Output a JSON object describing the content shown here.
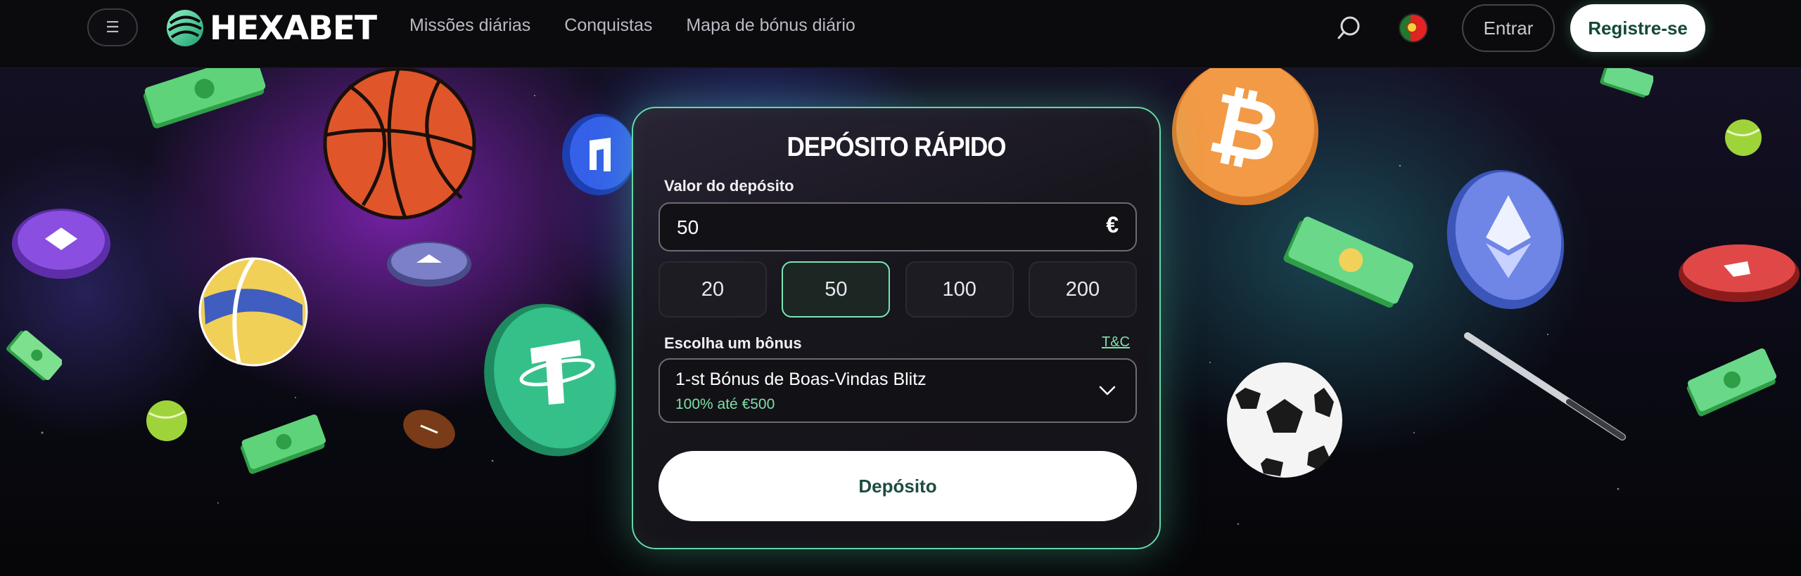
{
  "header": {
    "menu_icon": "hamburger-icon",
    "logo_text": "HEXABET",
    "nav": [
      "Missões diárias",
      "Conquistas",
      "Mapa de bónus diário"
    ],
    "search_icon": "search-icon",
    "language_flag": "portugal-flag-icon",
    "login_label": "Entrar",
    "register_label": "Registre-se"
  },
  "deposit_card": {
    "title": "DEPÓSITO RÁPIDO",
    "amount_label": "Valor do depósito",
    "amount_value": "50",
    "currency": "€",
    "presets": [
      "20",
      "50",
      "100",
      "200"
    ],
    "selected_preset": "50",
    "bonus_label": "Escolha um bônus",
    "terms_link": "T&C",
    "bonus_name": "1-st Bónus de Boas-Vindas Blitz",
    "bonus_detail": "100% até €500",
    "submit_label": "Depósito"
  },
  "colors": {
    "accent_green": "#63d7a8",
    "register_text": "#13493a",
    "bonus_text": "#7ee0a7"
  },
  "decorations": [
    "basketball-icon",
    "volleyball-icon",
    "football-icon",
    "soccer-ball-icon",
    "tennis-ball-icon",
    "bitcoin-coin-icon",
    "tether-coin-icon",
    "ethereum-coin-icon",
    "cash-bill-icon",
    "baseball-bat-icon"
  ]
}
